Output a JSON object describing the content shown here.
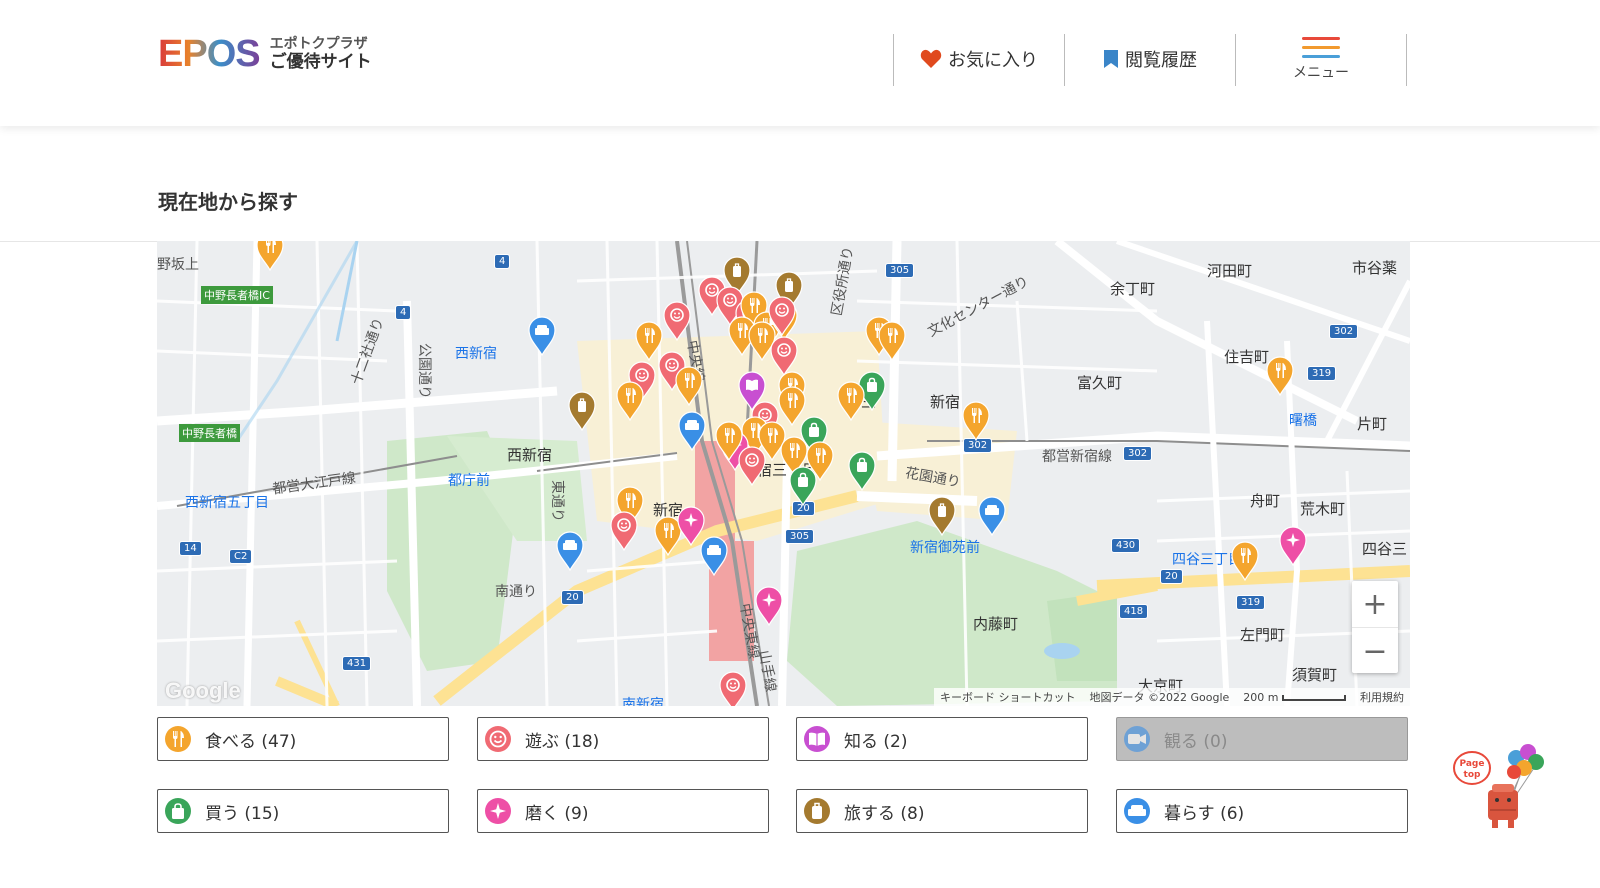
{
  "header": {
    "logo_text": "EPOS",
    "logo_sub1": "エポトクプラザ",
    "logo_sub2": "ご優待サイト",
    "favorites": "お気に入り",
    "history": "閲覧履歴",
    "menu": "メニュー",
    "hamburger_colors": [
      "#e8493a",
      "#f29a2e",
      "#4a9fd8"
    ]
  },
  "page": {
    "title": "現在地から探す"
  },
  "map": {
    "labels": {
      "nishishinjuku_st": "西新宿",
      "nishishinjuku": "西新宿",
      "tochomae": "都庁前",
      "nishishinjuku5": "西新宿五丁目",
      "shinjuku_gyoemmae": "新宿御苑前",
      "yotsuya3": "四谷三丁目",
      "akebonobashi": "曙橋",
      "yotsuya": "四谷三",
      "naitomachi": "内藤町",
      "tomihisacho": "富久町",
      "yochomachi": "余丁町",
      "kawadacho": "河田町",
      "ichigaya": "市谷薬",
      "sumiyoshicho": "住吉町",
      "katamachi": "片町",
      "funamachi": "舟町",
      "arakicho": "荒木町",
      "samoncho": "左門町",
      "sugacho": "須賀町",
      "daikyocho": "大京町",
      "shinjuku": "新宿",
      "minamishinjuku": "南新宿",
      "nakano_sakaue": "野坂上",
      "nakano_choja_ic": "中野長者橋IC",
      "nakano_choja": "中野長者橋",
      "toei_oedo": "都営大江戸線",
      "toei_shinjuku": "都営新宿線",
      "kuyakusho": "区役所通り",
      "bunka_center": "文化センター通り",
      "hanazono": "花園通り",
      "koen_dori": "公園通り",
      "higashi_dori": "東通り",
      "juniso": "十二社通り",
      "minami_dori": "南通り",
      "chuo_line": "中央線",
      "chuo_line2": "中央東線",
      "yamanote": "山手線",
      "sannomiya": "三",
      "shinjuku_bare": "新宿",
      "shinjuku3": "宿三丁目"
    },
    "route_numbers": [
      "4",
      "4",
      "305",
      "302",
      "302",
      "302",
      "319",
      "319",
      "430",
      "418",
      "20",
      "20",
      "20",
      "305",
      "14",
      "C2",
      "431"
    ],
    "attribution": {
      "shortcuts": "キーボード ショートカット",
      "data": "地図データ ©2022 Google",
      "scale": "200 m",
      "terms": "利用規約"
    },
    "google": "Google",
    "zoom_in": "+",
    "zoom_out": "−"
  },
  "categories": [
    {
      "label": "食べる (47)",
      "color": "#f4a52d",
      "icon": "fork-knife-icon"
    },
    {
      "label": "遊ぶ (18)",
      "color": "#f06a73",
      "icon": "smile-icon"
    },
    {
      "label": "知る (2)",
      "color": "#c84fd1",
      "icon": "book-icon"
    },
    {
      "label": "観る (0)",
      "color": "#3a8fe6",
      "icon": "video-icon",
      "disabled": true
    },
    {
      "label": "買う (15)",
      "color": "#3aa55a",
      "icon": "shopping-bag-icon"
    },
    {
      "label": "磨く (9)",
      "color": "#ee4fa6",
      "icon": "sparkle-icon"
    },
    {
      "label": "旅する (8)",
      "color": "#a47a2f",
      "icon": "suitcase-icon"
    },
    {
      "label": "暮らす (6)",
      "color": "#3a8fe6",
      "icon": "sofa-icon"
    }
  ],
  "pagetop": {
    "line1": "Page",
    "line2": "top"
  }
}
